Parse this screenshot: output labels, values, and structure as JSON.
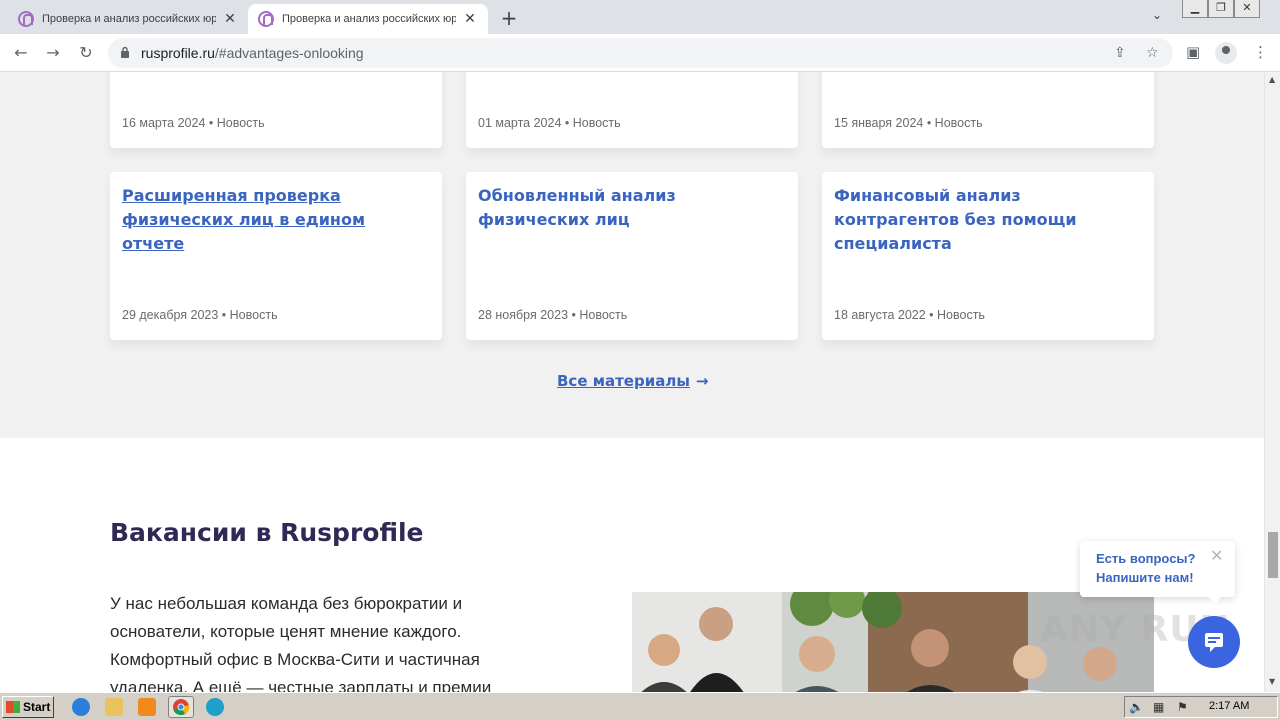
{
  "browser": {
    "tabs": [
      {
        "title": "Проверка и анализ российских юр",
        "active": false
      },
      {
        "title": "Проверка и анализ российских юр",
        "active": true
      }
    ],
    "new_tab_symbol": "+",
    "url_host": "rusprofile.ru",
    "url_path": "/#advantages-onlooking"
  },
  "news_cards_top": [
    {
      "meta": "16 марта 2024 • Новость"
    },
    {
      "meta": "01 марта 2024 • Новость"
    },
    {
      "meta": "15 января 2024 • Новость"
    }
  ],
  "news_cards": [
    {
      "title": "Расширенная проверка физических лиц в едином отчете",
      "meta": "29 декабря 2023 • Новость"
    },
    {
      "title": "Обновленный анализ физических лиц",
      "meta": "28 ноября 2023 • Новость"
    },
    {
      "title": "Финансовый анализ контрагентов без помощи специалиста",
      "meta": "18 августа 2022 • Новость"
    }
  ],
  "all_materials": {
    "label": "Все материалы",
    "arrow": "→"
  },
  "vacancies": {
    "title": "Вакансии в Rusprofile",
    "text": "У нас небольшая команда без бюрократии и основатели, которые ценят мнение каждого. Комфортный офис в Москва-Сити и частичная удаленка. А ещё — честные зарплаты и премии"
  },
  "chat": {
    "line1": "Есть вопросы?",
    "line2": "Напишите нам!",
    "close": "✕"
  },
  "watermark": "ANY RUN",
  "taskbar": {
    "start_label": "Start",
    "clock": "2:17 AM"
  },
  "colors": {
    "link": "#3a64bf",
    "heading": "#2e2a55",
    "chat_button": "#3a64e0"
  }
}
